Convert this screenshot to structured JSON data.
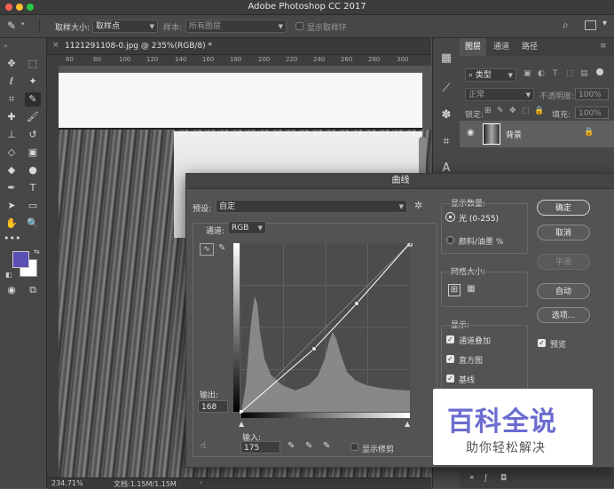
{
  "window": {
    "title": "Adobe Photoshop CC 2017"
  },
  "options_bar": {
    "sample_size_label": "取样大小:",
    "sample_size_value": "取样点",
    "sample_label": "样本:",
    "sample_value": "所有图层",
    "show_ring_label": "显示取样环"
  },
  "document": {
    "tab_title": "1121291108-0.jpg @ 235%(RGB/8) *",
    "ruler_ticks": [
      "60",
      "80",
      "100",
      "120",
      "140",
      "160",
      "180",
      "200",
      "220",
      "240",
      "260",
      "280",
      "300"
    ]
  },
  "status": {
    "zoom": "234.71%",
    "doc_size": "文档:1.15M/1.15M"
  },
  "layers_panel": {
    "tabs": [
      "图层",
      "通道",
      "路径"
    ],
    "filter_kind": "类型",
    "blend_mode": "正常",
    "opacity_label": "不透明度:",
    "opacity_value": "100%",
    "lock_label": "锁定:",
    "fill_label": "填充:",
    "fill_value": "100%",
    "layer_name": "背景"
  },
  "curves_dialog": {
    "title": "曲线",
    "preset_label": "预设:",
    "preset_value": "自定",
    "channel_label": "通道:",
    "channel_value": "RGB",
    "output_label": "输出:",
    "output_value": "168",
    "input_label": "输入:",
    "input_value": "175",
    "show_clipping_label": "显示修剪",
    "display_amount_title": "显示数量:",
    "light_label": "光 (0-255)",
    "pigment_label": "颜料/油墨 %",
    "grid_size_title": "网格大小:",
    "show_title": "显示:",
    "channel_overlay_label": "通道叠加",
    "histogram_label": "直方图",
    "baseline_label": "基线",
    "buttons": {
      "ok": "确定",
      "cancel": "取消",
      "smooth": "平滑",
      "auto": "自动",
      "options": "选项..."
    },
    "preview_label": "预览"
  },
  "watermark": {
    "title": "百科全说",
    "subtitle": "助你轻松解决"
  },
  "colors": {
    "foreground": "#5a4fb3",
    "background": "#ffffff",
    "accent": "#6c6cd0"
  }
}
